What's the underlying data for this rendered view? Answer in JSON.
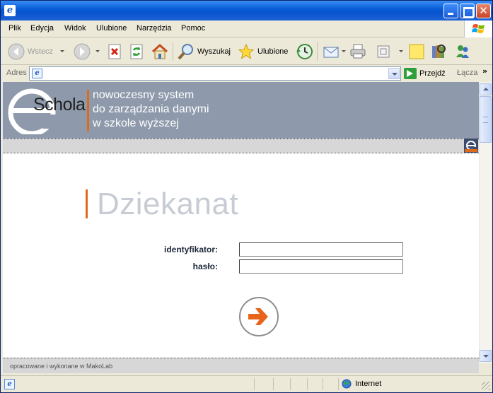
{
  "window": {
    "title": ""
  },
  "menu": {
    "items": [
      "Plik",
      "Edycja",
      "Widok",
      "Ulubione",
      "Narzędzia",
      "Pomoc"
    ]
  },
  "toolbar": {
    "back_label": "Wstecz",
    "search_label": "Wyszukaj",
    "favorites_label": "Ulubione"
  },
  "address": {
    "label": "Adres",
    "value": "",
    "go_label": "Przejdź",
    "links_label": "Łącza"
  },
  "page": {
    "brand": "Schola",
    "tagline": [
      "nowoczesny system",
      "do zarządzania danymi",
      "w szkole wyższej"
    ],
    "heading": "Dziekanat",
    "form": {
      "login_label": "identyfikator:",
      "login_value": "",
      "password_label": "hasło:",
      "password_value": ""
    },
    "footer_text": "opracowane i wykonane w MakoLab"
  },
  "status": {
    "text": "",
    "zone": "Internet"
  },
  "colors": {
    "accent_orange": "#e06a1b",
    "banner_gray": "#8e9aab",
    "heading_gray": "#c7ccd4"
  },
  "icons": {
    "back": "back-arrow-icon",
    "forward": "forward-arrow-icon",
    "stop": "stop-icon",
    "refresh": "refresh-icon",
    "home": "home-icon",
    "search": "magnifier-icon",
    "favorites": "star-icon",
    "history": "history-icon",
    "mail": "mail-icon",
    "print": "printer-icon",
    "edit": "edit-icon",
    "notes": "note-icon",
    "research": "research-icon",
    "messenger": "messenger-icon",
    "submit": "orange-arrow-icon"
  }
}
